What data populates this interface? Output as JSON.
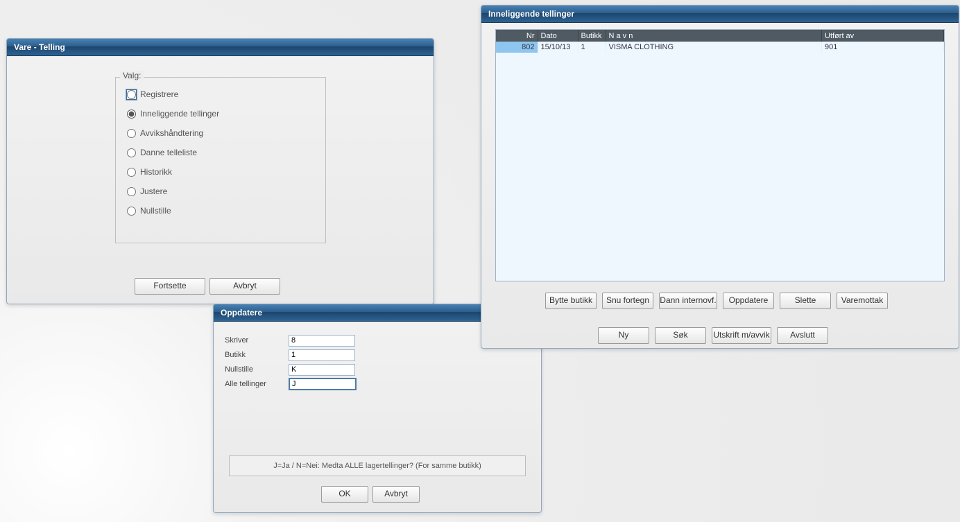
{
  "vare_telling": {
    "title": "Vare - Telling",
    "legend": "Valg:",
    "options": {
      "registrere": "Registrere",
      "inneliggende": "Inneliggende tellinger",
      "avvik": "Avvikshåndtering",
      "danne": "Danne telleliste",
      "historikk": "Historikk",
      "justere": "Justere",
      "nullstille": "Nullstille"
    },
    "buttons": {
      "fortsette": "Fortsette",
      "avbryt": "Avbryt"
    }
  },
  "oppdatere": {
    "title": "Oppdatere",
    "fields": {
      "skriver_label": "Skriver",
      "skriver_value": "8",
      "butikk_label": "Butikk",
      "butikk_value": "1",
      "nullstille_label": "Nullstille",
      "nullstille_value": "K",
      "alle_label": "Alle tellinger",
      "alle_value": "J"
    },
    "hint": "J=Ja / N=Nei: Medta ALLE lagertellinger? (For samme butikk)",
    "buttons": {
      "ok": "OK",
      "avbryt": "Avbryt"
    }
  },
  "inneliggende": {
    "title": "Inneliggende tellinger",
    "headers": {
      "nr": "Nr",
      "dato": "Dato",
      "butikk": "Butikk",
      "navn": "N a v n",
      "utfort": "Utført av"
    },
    "row": {
      "nr": "802",
      "dato": "15/10/13",
      "butikk": "1",
      "navn": "VISMA CLOTHING",
      "utfort": "901"
    },
    "buttons1": {
      "bytte": "Bytte butikk",
      "snu": "Snu fortegn",
      "dann": "Dann internovf.",
      "oppdatere": "Oppdatere",
      "slette": "Slette",
      "varemottak": "Varemottak"
    },
    "buttons2": {
      "ny": "Ny",
      "sok": "Søk",
      "utskrift": "Utskrift m/avvik",
      "avslutt": "Avslutt"
    }
  }
}
